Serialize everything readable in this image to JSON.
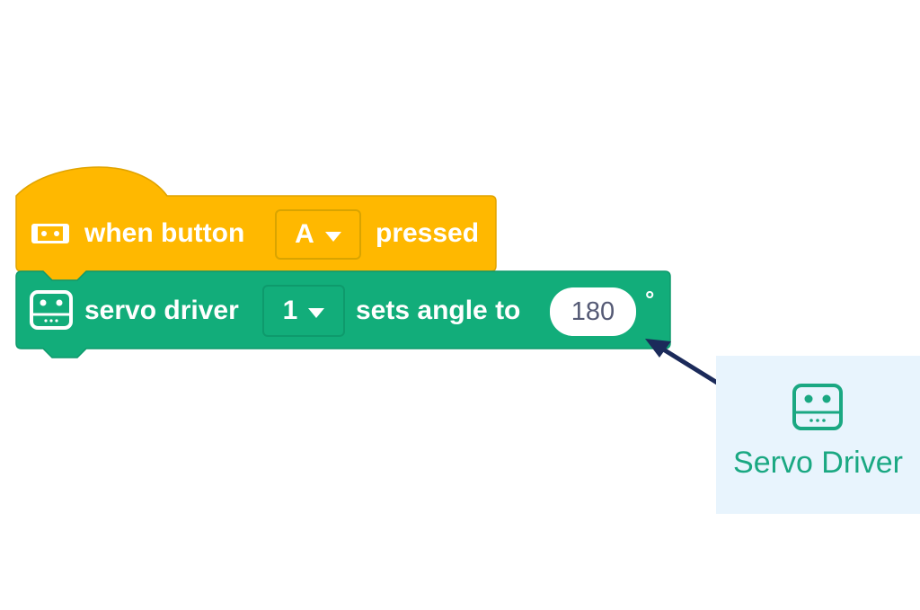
{
  "hat_block": {
    "label_before": "when button",
    "button_value": "A",
    "label_after": "pressed",
    "color": "#ffb800"
  },
  "servo_block": {
    "label_before": "servo driver",
    "driver_value": "1",
    "label_middle": "sets angle to",
    "angle_value": "180",
    "unit": "°",
    "color": "#12ad7a"
  },
  "extension": {
    "label": "Servo Driver",
    "icon": "servo-driver-icon",
    "background": "#e8f4fd",
    "color": "#1aa882"
  },
  "icons": {
    "hat": "microbit-board-icon",
    "servo": "servo-driver-icon",
    "dropdown": "caret-down-icon"
  },
  "arrow_color": "#1b2a5a"
}
